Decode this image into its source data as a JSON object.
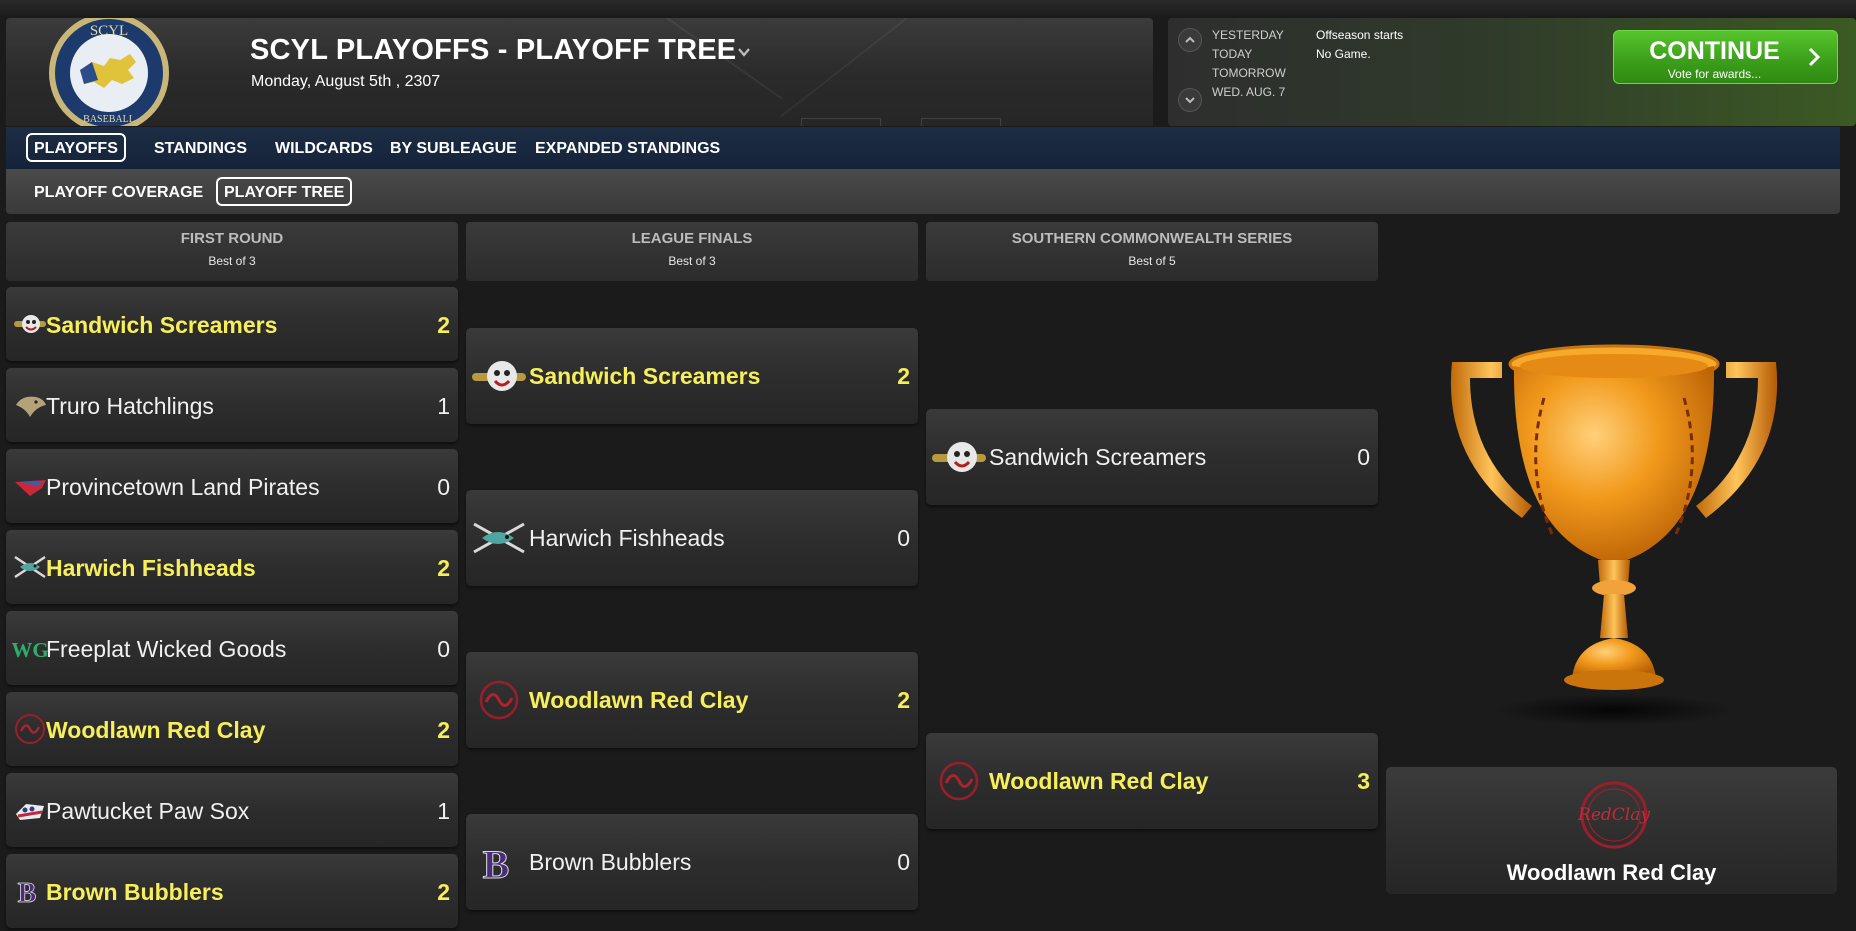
{
  "header": {
    "title": "SCYL PLAYOFFS - PLAYOFF TREE",
    "date": "Monday, August 5th , 2307",
    "logo_top_text": "SCYL",
    "logo_bottom_text": "BASEBALL"
  },
  "schedule": {
    "labels": [
      "YESTERDAY",
      "TODAY",
      "TOMORROW",
      "WED. AUG. 7"
    ],
    "values": [
      "Offseason starts",
      "No Game."
    ]
  },
  "continue_button": {
    "label": "CONTINUE",
    "sublabel": "Vote for awards..."
  },
  "tabs_primary": [
    "PLAYOFFS",
    "STANDINGS",
    "WILDCARDS",
    "BY SUBLEAGUE",
    "EXPANDED STANDINGS"
  ],
  "tabs_secondary": [
    "PLAYOFF COVERAGE",
    "PLAYOFF TREE"
  ],
  "rounds": [
    {
      "title": "FIRST ROUND",
      "subtitle": "Best of 3"
    },
    {
      "title": "LEAGUE FINALS",
      "subtitle": "Best of 3"
    },
    {
      "title": "SOUTHERN COMMONWEALTH SERIES",
      "subtitle": "Best of 5"
    }
  ],
  "first_round": [
    {
      "team": "Sandwich Screamers",
      "score": "2",
      "winner": true,
      "logo": "screamers-logo"
    },
    {
      "team": "Truro Hatchlings",
      "score": "1",
      "winner": false,
      "logo": "hatchlings-logo"
    },
    {
      "team": "Provincetown Land Pirates",
      "score": "0",
      "winner": false,
      "logo": "land-pirates-logo"
    },
    {
      "team": "Harwich Fishheads",
      "score": "2",
      "winner": true,
      "logo": "fishheads-logo"
    },
    {
      "team": "Freeplat Wicked Goods",
      "score": "0",
      "winner": false,
      "logo": "wicked-goods-logo"
    },
    {
      "team": "Woodlawn Red Clay",
      "score": "2",
      "winner": true,
      "logo": "red-clay-logo"
    },
    {
      "team": "Pawtucket Paw Sox",
      "score": "1",
      "winner": false,
      "logo": "paw-sox-logo"
    },
    {
      "team": "Brown Bubblers",
      "score": "2",
      "winner": true,
      "logo": "bubblers-logo"
    }
  ],
  "league_finals": [
    {
      "team": "Sandwich Screamers",
      "score": "2",
      "winner": true
    },
    {
      "team": "Harwich Fishheads",
      "score": "0",
      "winner": false
    },
    {
      "team": "Woodlawn Red Clay",
      "score": "2",
      "winner": true
    },
    {
      "team": "Brown Bubblers",
      "score": "0",
      "winner": false
    }
  ],
  "series": [
    {
      "team": "Sandwich Screamers",
      "score": "0",
      "winner": false
    },
    {
      "team": "Woodlawn Red Clay",
      "score": "3",
      "winner": true
    }
  ],
  "champion": {
    "team": "Woodlawn Red Clay",
    "logo_text": "RedClay"
  },
  "colors": {
    "winner_text": "#f7ef5a",
    "continue_green": "#3b9d1a",
    "nav_blue": "#15233a",
    "trophy_gold": "#f29a1c"
  },
  "logo_letters": {
    "bubblers": "B",
    "wicked_goods": "WG"
  }
}
